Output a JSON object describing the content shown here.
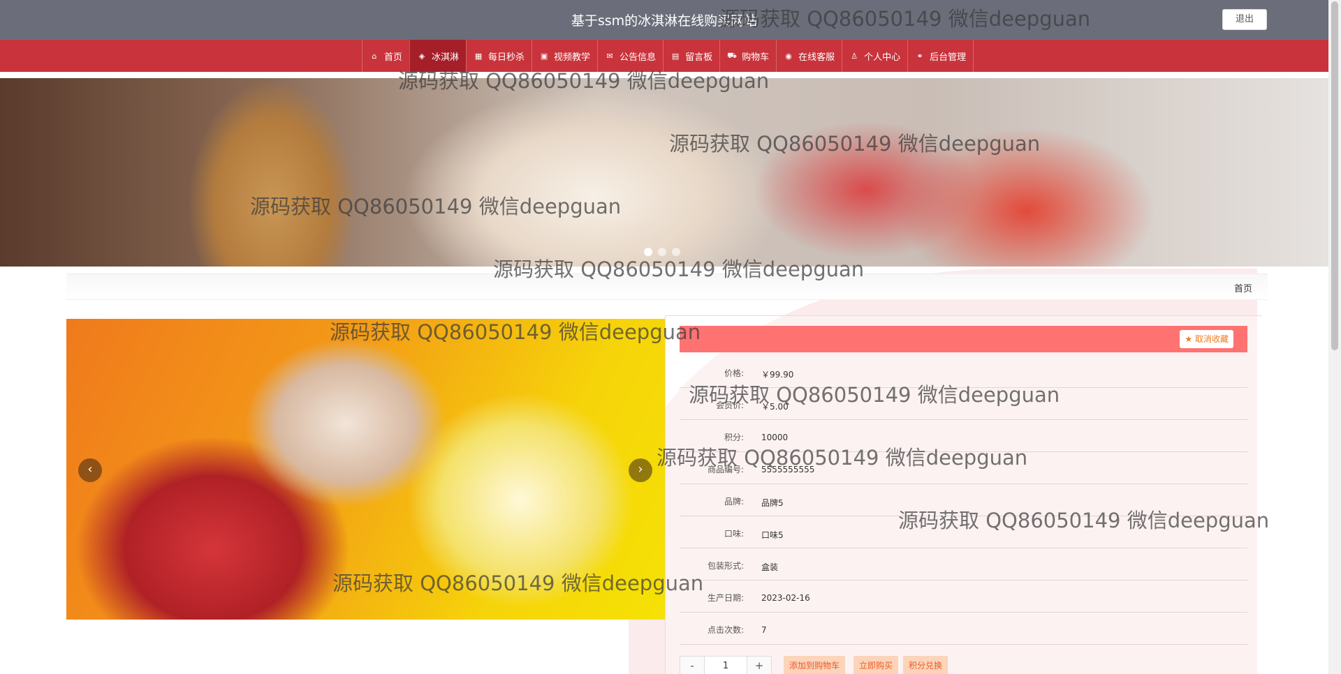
{
  "header": {
    "title": "基于ssm的冰淇淋在线购买网站",
    "logout_label": "退出"
  },
  "nav": {
    "items": [
      {
        "label": "首页",
        "icon": "home-icon",
        "glyph": "⌂"
      },
      {
        "label": "冰淇淋",
        "icon": "layers-icon",
        "glyph": "◈"
      },
      {
        "label": "每日秒杀",
        "icon": "calendar-icon",
        "glyph": "▦"
      },
      {
        "label": "视频教学",
        "icon": "video-icon",
        "glyph": "▣"
      },
      {
        "label": "公告信息",
        "icon": "mail-icon",
        "glyph": "✉"
      },
      {
        "label": "留言板",
        "icon": "board-icon",
        "glyph": "▤"
      },
      {
        "label": "购物车",
        "icon": "cart-icon",
        "glyph": "⛟"
      },
      {
        "label": "在线客服",
        "icon": "chat-icon",
        "glyph": "◉"
      },
      {
        "label": "个人中心",
        "icon": "user-icon",
        "glyph": "♙"
      },
      {
        "label": "后台管理",
        "icon": "link-icon",
        "glyph": "⚭"
      }
    ]
  },
  "breadcrumb": {
    "home": "首页"
  },
  "product": {
    "fav_label": "取消收藏",
    "fields": [
      {
        "label": "价格:",
        "value": "￥99.90"
      },
      {
        "label": "会员价:",
        "value": "￥5.00"
      },
      {
        "label": "积分:",
        "value": "10000"
      },
      {
        "label": "商品编号:",
        "value": "5555555555"
      },
      {
        "label": "品牌:",
        "value": "品牌5"
      },
      {
        "label": "口味:",
        "value": "口味5"
      },
      {
        "label": "包装形式:",
        "value": "盒装"
      },
      {
        "label": "生产日期:",
        "value": "2023-02-16"
      },
      {
        "label": "点击次数:",
        "value": "7"
      }
    ],
    "quantity": "1",
    "minus": "-",
    "plus": "+",
    "actions": {
      "add_cart": "添加到购物车",
      "buy_now": "立即购买",
      "points_redeem": "积分兑换"
    }
  },
  "watermark": "源码获取 QQ86050149 微信deepguan",
  "colors": {
    "header_bg": "#6b6e7a",
    "nav_bg": "#c9333b",
    "detail_header": "#ff7272",
    "action_btn_bg": "#fbd4b9"
  }
}
